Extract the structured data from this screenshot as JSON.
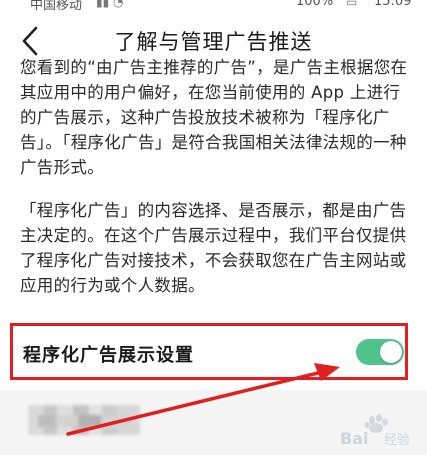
{
  "status_bar": {
    "carrier": "中国移动",
    "battery": "100%",
    "time": "15:09",
    "signal_icon": "signal-icon",
    "wifi_icon": "wifi-icon",
    "battery_icon": "battery-icon"
  },
  "header": {
    "title": "了解与管理广告推送",
    "back_icon": "back-arrow-icon"
  },
  "content": {
    "paragraph_1": "您看到的“由广告主推荐的广告”，是广告主根据您在其应用中的用户偏好，在您当前使用的 App 上进行的广告展示，这种广告投放技术被称为「程序化广告」。「程序化广告」是符合我国相关法律法规的一种广告形式。",
    "paragraph_2": "「程序化广告」的内容选择、是否展示，都是由广告主决定的。在这个广告展示过程中，我们平台仅提供了程序化广告对接技术，不会获取您在广告主网站或应用的行为或个人数据。"
  },
  "setting": {
    "label": "程序化广告展示设置",
    "enabled": true
  },
  "colors": {
    "toggle_on": "#4fc38a",
    "highlight_border": "#e02020",
    "annotation_arrow": "#e02020"
  },
  "watermark": {
    "brand": "Bai",
    "brand_suffix": "经验",
    "icon": "baidu-paw-icon"
  }
}
